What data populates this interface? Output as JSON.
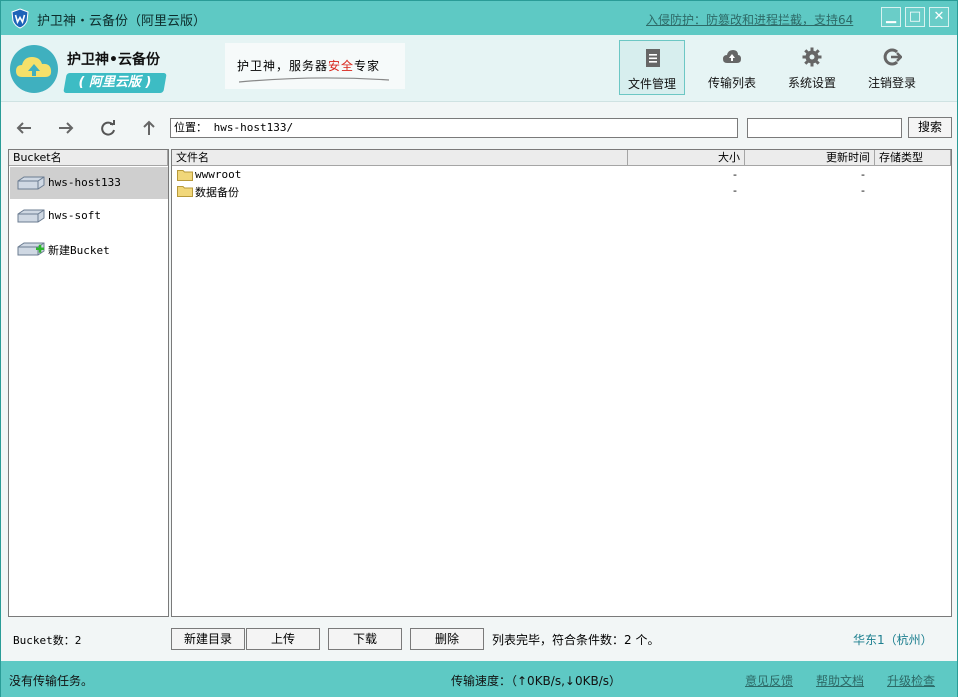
{
  "titlebar": {
    "title": "护卫神・云备份（阿里云版）",
    "link": "入侵防护：防篡改和进程拦截，支持64",
    "min": "▁",
    "max": "□",
    "close": "✕"
  },
  "header": {
    "brand_name": "护卫神•云备份",
    "brand_badge": "( 阿里云版 )",
    "slogan_prefix": "护卫神，服务器",
    "slogan_red": "安全",
    "slogan_suffix": "专家",
    "nav": [
      {
        "label": "文件管理",
        "icon": "document-icon",
        "active": true
      },
      {
        "label": "传输列表",
        "icon": "cloud-upload-icon",
        "active": false
      },
      {
        "label": "系统设置",
        "icon": "gear-icon",
        "active": false
      },
      {
        "label": "注销登录",
        "icon": "logout-icon",
        "active": false
      }
    ]
  },
  "toolbar": {
    "path_label": "位置：",
    "path_value": "hws-host133/",
    "search_placeholder": "",
    "search_button": "搜索"
  },
  "left_panel": {
    "header": "Bucket名",
    "items": [
      {
        "label": "hws-host133",
        "selected": true
      },
      {
        "label": "hws-soft",
        "selected": false
      },
      {
        "label": "新建Bucket",
        "selected": false
      }
    ]
  },
  "file_table": {
    "columns": [
      "文件名",
      "大小",
      "更新时间",
      "存储类型"
    ],
    "rows": [
      {
        "name": "wwwroot",
        "size": "-",
        "time": "-",
        "storage": ""
      },
      {
        "name": "数据备份",
        "size": "-",
        "time": "-",
        "storage": ""
      }
    ]
  },
  "actions": {
    "bucket_count": "Bucket数：2",
    "new_dir": "新建目录",
    "upload": "上传",
    "download": "下载",
    "delete": "删除",
    "status": "列表完毕，符合条件数：2 个。",
    "region": "华东1（杭州）"
  },
  "statusbar": {
    "left": "没有传输任务。",
    "speed": "传输速度：（↑0KB/s,↓0KB/s）",
    "feedback": "意见反馈",
    "help": "帮助文档",
    "upgrade": "升级检查"
  },
  "colors": {
    "titlebar": "#5ec9c4",
    "accent": "#3dbcc4",
    "slogan_red": "#d9261c"
  }
}
